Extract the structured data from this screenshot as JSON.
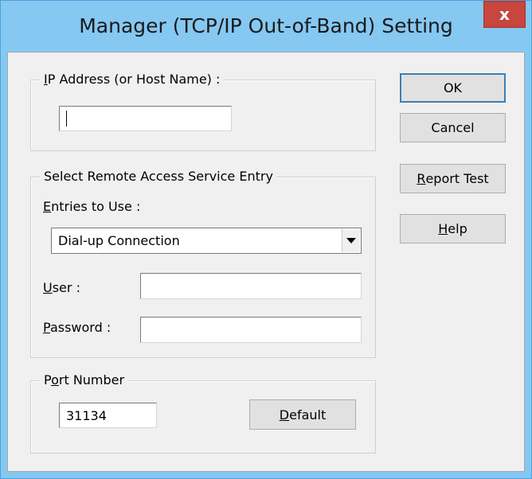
{
  "window": {
    "title": "Manager (TCP/IP Out-of-Band) Setting",
    "close_glyph": "x"
  },
  "ip_group": {
    "legend_accel": "I",
    "legend_rest": "P Address (or Host Name) :",
    "ip_value": ""
  },
  "ras_group": {
    "legend": "Select Remote Access Service Entry",
    "entries_accel": "E",
    "entries_rest": "ntries to Use :",
    "entries_selected": "Dial-up Connection",
    "user_accel": "U",
    "user_rest": "ser :",
    "user_value": "",
    "password_accel": "P",
    "password_rest": "assword :",
    "password_value": ""
  },
  "port_group": {
    "legend_pre": "P",
    "legend_accel": "o",
    "legend_rest": "rt Number",
    "port_value": "31134",
    "default_accel": "D",
    "default_rest": "efault"
  },
  "buttons": {
    "ok": "OK",
    "cancel": "Cancel",
    "report_accel": "R",
    "report_rest": "eport Test",
    "help_accel": "H",
    "help_rest": "elp"
  }
}
